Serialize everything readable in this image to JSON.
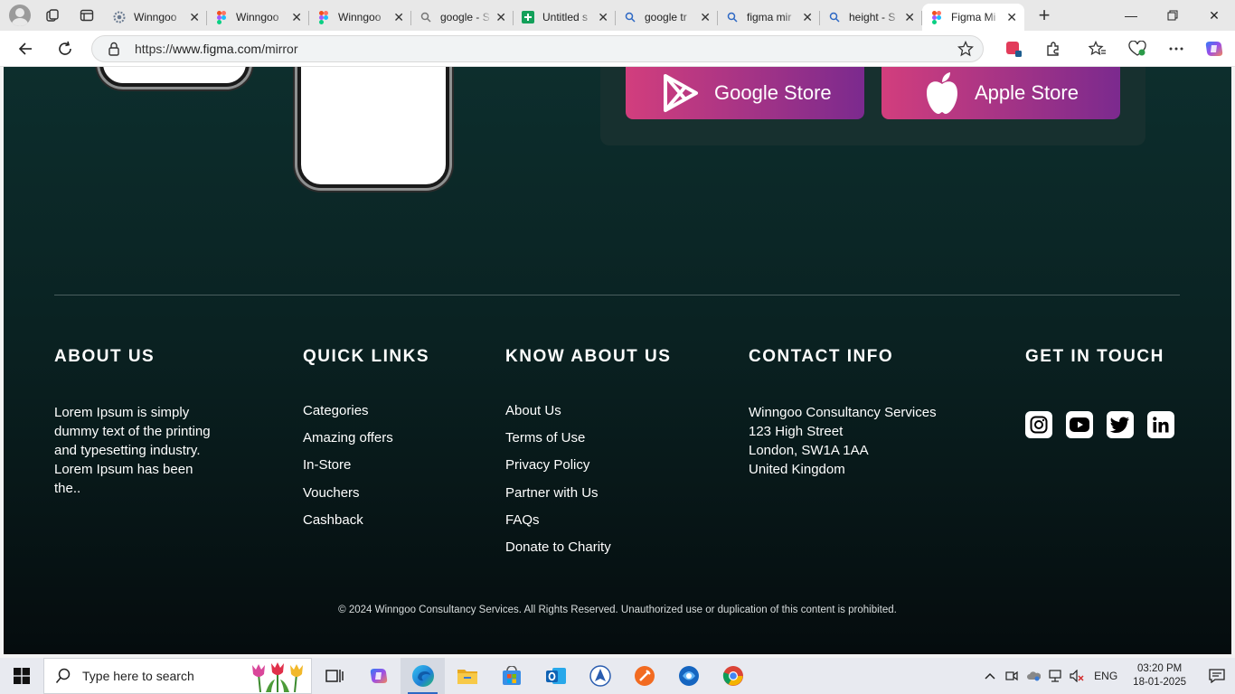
{
  "browser": {
    "tabs": [
      {
        "title": "Winngoo",
        "icon": "gear-favicon-icon"
      },
      {
        "title": "Winngoo",
        "icon": "figma-favicon-icon"
      },
      {
        "title": "Winngoo",
        "icon": "figma-favicon-icon"
      },
      {
        "title": "google - S",
        "icon": "search-favicon-icon"
      },
      {
        "title": "Untitled s",
        "icon": "sheets-favicon-icon"
      },
      {
        "title": "google tr",
        "icon": "search-favicon-icon"
      },
      {
        "title": "figma mir",
        "icon": "search-favicon-icon"
      },
      {
        "title": "height - S",
        "icon": "search-favicon-icon"
      },
      {
        "title": "Figma Mi",
        "icon": "figma-favicon-icon",
        "active": true
      }
    ],
    "url_scheme": "https://",
    "url_host": "www.figma.com",
    "url_path": "/mirror"
  },
  "page": {
    "stores": {
      "google": "Google Store",
      "apple": "Apple Store"
    },
    "footer": {
      "about": {
        "heading": "ABOUT US",
        "text": "Lorem Ipsum is simply dummy text of the printing and typesetting industry. Lorem Ipsum has been the.."
      },
      "quick_links": {
        "heading": "QUICK LINKS",
        "items": [
          "Categories",
          "Amazing offers",
          "In-Store",
          "Vouchers",
          "Cashback"
        ]
      },
      "know_about": {
        "heading": "KNOW ABOUT US",
        "items": [
          "About Us",
          "Terms of Use",
          "Privacy Policy",
          "Partner with Us",
          "FAQs",
          "Donate to Charity"
        ]
      },
      "contact": {
        "heading": "CONTACT INFO",
        "lines": [
          "Winngoo Consultancy Services",
          "123 High Street",
          "London, SW1A 1AA",
          "United Kingdom"
        ]
      },
      "social": {
        "heading": "GET IN TOUCH",
        "icons": [
          "instagram-icon",
          "youtube-icon",
          "twitter-icon",
          "linkedin-icon"
        ]
      },
      "copyright": "© 2024 Winngoo Consultancy Services. All Rights Reserved. Unauthorized use or duplication of this content is prohibited."
    },
    "colors": {
      "bg_top": "#0d2e2d",
      "bg_bottom": "#050c0e",
      "store_gradient_start": "#d23e7d",
      "store_gradient_end": "#7b2a8e"
    }
  },
  "taskbar": {
    "search_placeholder": "Type here to search",
    "language": "ENG",
    "time": "03:20 PM",
    "date": "18-01-2025"
  }
}
